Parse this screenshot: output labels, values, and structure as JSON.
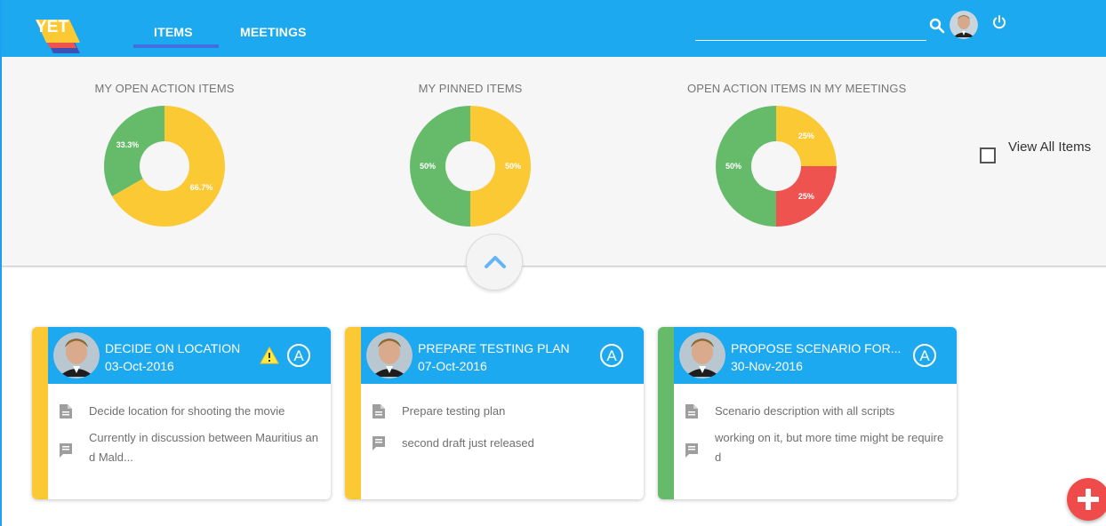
{
  "header": {
    "logo_text": "YET",
    "tabs": [
      {
        "label": "ITEMS",
        "active": true
      },
      {
        "label": "MEETINGS",
        "active": false
      }
    ],
    "search": {
      "value": "",
      "placeholder": ""
    }
  },
  "summary": {
    "view_all_label": "View All Items",
    "view_all_checked": false
  },
  "chart_data": [
    {
      "type": "pie",
      "title": "MY OPEN ACTION ITEMS",
      "slices": [
        {
          "value": 66.7,
          "label": "66.7%",
          "color": "#fbc934"
        },
        {
          "value": 33.3,
          "label": "33.3%",
          "color": "#66bb6a"
        }
      ]
    },
    {
      "type": "pie",
      "title": "MY PINNED ITEMS",
      "slices": [
        {
          "value": 50,
          "label": "50%",
          "color": "#fbc934"
        },
        {
          "value": 50,
          "label": "50%",
          "color": "#66bb6a"
        }
      ]
    },
    {
      "type": "pie",
      "title": "OPEN ACTION ITEMS IN MY MEETINGS",
      "slices": [
        {
          "value": 25,
          "label": "25%",
          "color": "#fbc934"
        },
        {
          "value": 25,
          "label": "25%",
          "color": "#ef5350"
        },
        {
          "value": 50,
          "label": "50%",
          "color": "#66bb6a"
        }
      ]
    }
  ],
  "cards": [
    {
      "title": "DECIDE ON LOCATION",
      "date": "03-Oct-2016",
      "stripe_color": "#fbc934",
      "warning": true,
      "assign_badge": "A",
      "description": "Decide location for shooting the movie",
      "comment": "Currently in discussion between Mauritius and Mald..."
    },
    {
      "title": "PREPARE TESTING PLAN",
      "date": "07-Oct-2016",
      "stripe_color": "#fbc934",
      "warning": false,
      "assign_badge": "A",
      "description": "Prepare testing plan",
      "comment": "second draft just released"
    },
    {
      "title": "PROPOSE SCENARIO FOR...",
      "date": "30-Nov-2016",
      "stripe_color": "#66bb6a",
      "warning": false,
      "assign_badge": "A",
      "description": "Scenario description with all scripts",
      "comment": "working on it, but more time might be required"
    }
  ],
  "colors": {
    "brand_blue": "#1da9f0",
    "tab_indicator": "#3f6fe0",
    "fab_red": "#ef4b4b"
  },
  "icons": {
    "search": "search-icon",
    "power": "power-icon",
    "collapse": "chevron-up-icon",
    "add": "plus-icon",
    "description": "document-icon",
    "comment": "comment-icon",
    "warning": "warning-icon",
    "assign": "assign-badge-icon"
  }
}
